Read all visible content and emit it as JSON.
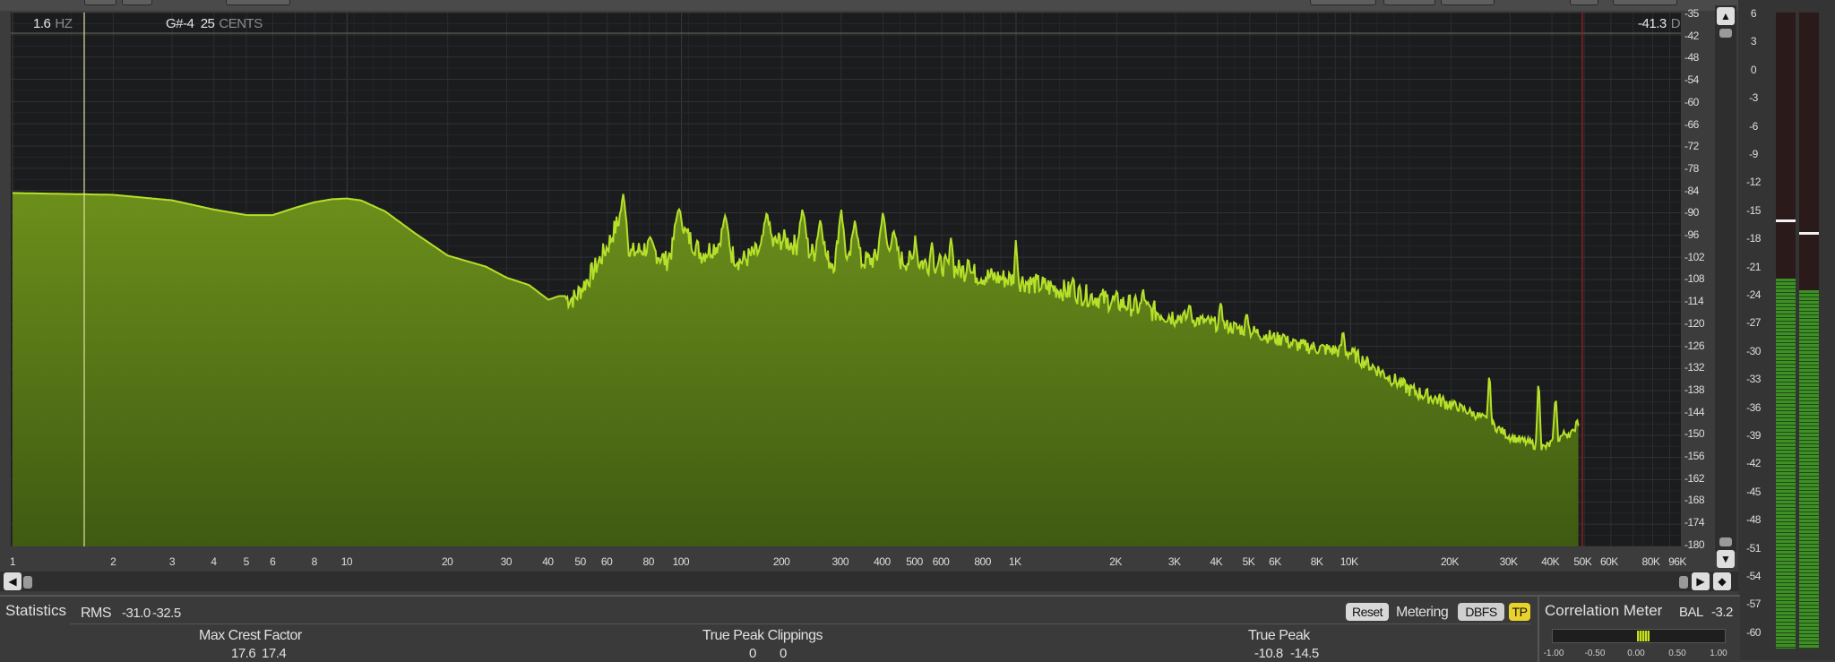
{
  "readout": {
    "freq_value": "1.6",
    "freq_unit": "HZ",
    "note": "G#-4",
    "cents_value": "25",
    "cents_unit": "CENTS",
    "level_value": "-41.3",
    "level_unit": "DB"
  },
  "db_ticks": [
    "-35",
    "-42",
    "-48",
    "-54",
    "-60",
    "-66",
    "-72",
    "-78",
    "-84",
    "-90",
    "-96",
    "-102",
    "-108",
    "-114",
    "-120",
    "-126",
    "-132",
    "-138",
    "-144",
    "-150",
    "-156",
    "-162",
    "-168",
    "-174",
    "-180"
  ],
  "freq_ticks": [
    "1",
    "2",
    "3",
    "4",
    "5",
    "6",
    "8",
    "10",
    "20",
    "30",
    "40",
    "50",
    "60",
    "80",
    "100",
    "200",
    "300",
    "400",
    "500",
    "600",
    "800",
    "1K",
    "2K",
    "3K",
    "4K",
    "5K",
    "6K",
    "8K",
    "10K",
    "20K",
    "30K",
    "40K",
    "50K",
    "60K",
    "80K",
    "96K"
  ],
  "meter_ticks": [
    "6",
    "3",
    "0",
    "-3",
    "-6",
    "-9",
    "-12",
    "-15",
    "-18",
    "-21",
    "-24",
    "-27",
    "-30",
    "-33",
    "-36",
    "-39",
    "-42",
    "-45",
    "-48",
    "-51",
    "-54",
    "-57",
    "-60"
  ],
  "meter_levels": {
    "left_db": -21.6,
    "right_db": -22.8,
    "left_peak_db": -15.5,
    "right_peak_db": -16.8
  },
  "statistics": {
    "tab_label": "Statistics",
    "rms_label": "RMS",
    "rms_left": "-31.0",
    "rms_right": "-32.5",
    "crest_label": "Max Crest Factor",
    "crest_left": "17.6",
    "crest_right": "17.4",
    "clip_label": "True Peak Clippings",
    "clip_left": "0",
    "clip_right": "0",
    "tp_label": "True Peak",
    "tp_left": "-10.8",
    "tp_right": "-14.5"
  },
  "controls": {
    "reset_label": "Reset",
    "metering_label": "Metering",
    "dbfs_label": "DBFS",
    "tp_label": "TP"
  },
  "correlation": {
    "title": "Correlation Meter",
    "bal_label": "BAL",
    "bal_value": "-3.2",
    "value": 0.05,
    "ticks": [
      "-1.00",
      "-0.50",
      "0.00",
      "0.50",
      "1.00"
    ]
  },
  "colors": {
    "spectrum_fill": "#6a8c1a",
    "spectrum_line": "#b6e02a",
    "background": "#1b1c1e",
    "marker": "#e0e0a0",
    "limit_line": "#8a1e1e"
  }
}
